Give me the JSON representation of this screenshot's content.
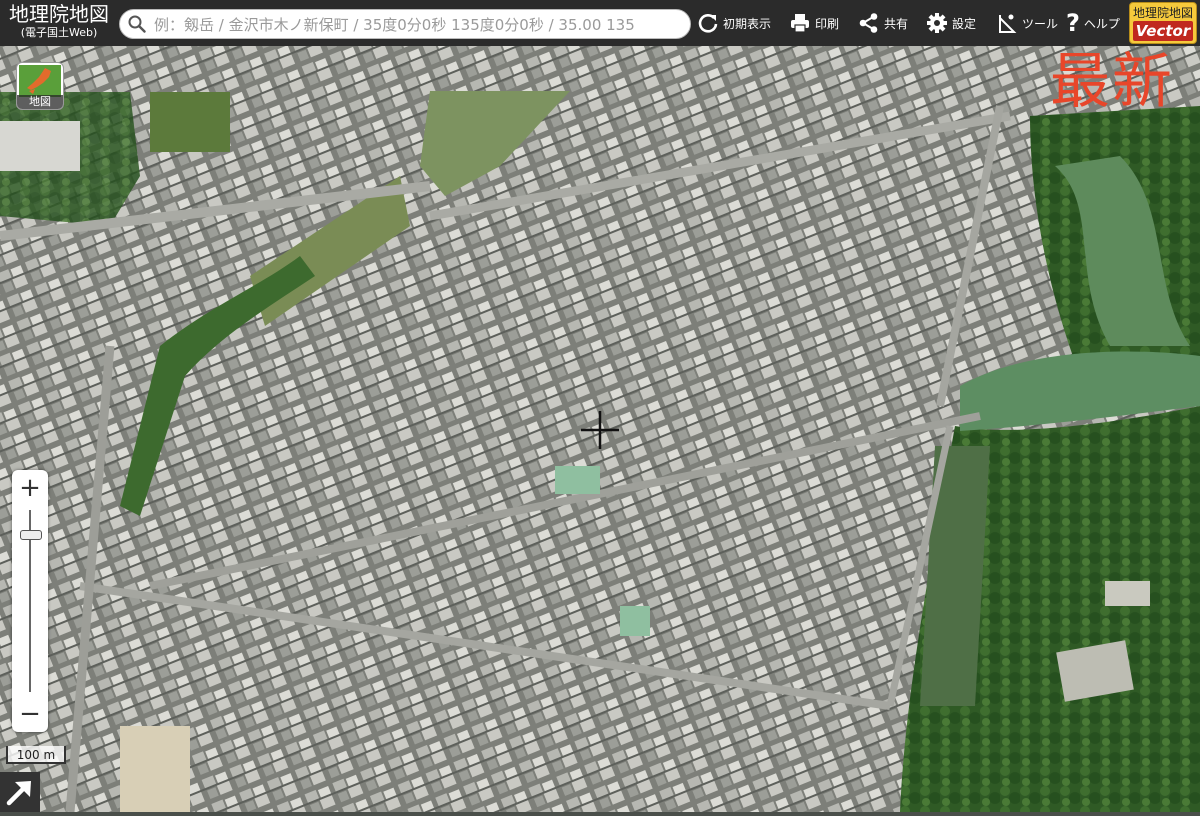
{
  "header": {
    "logo_title": "地理院地図",
    "logo_subtitle": "(電子国土Web)",
    "search_placeholder": "例：剱岳 / 金沢市木ノ新保町 / 35度0分0秒 135度0分0秒 / 35.00 135",
    "reset_label": "初期表示",
    "print_label": "印刷",
    "share_label": "共有",
    "settings_label": "設定",
    "tools_label": "ツール",
    "help_label": "ヘルプ",
    "vector_top": "地理院地図",
    "vector_bottom": "Vector"
  },
  "map": {
    "overlay_label": "最新",
    "layer_button_label": "地図",
    "scale_label": "100 m",
    "zoom_in": "+",
    "zoom_out": "−",
    "overlay_color": "#e8462a"
  }
}
